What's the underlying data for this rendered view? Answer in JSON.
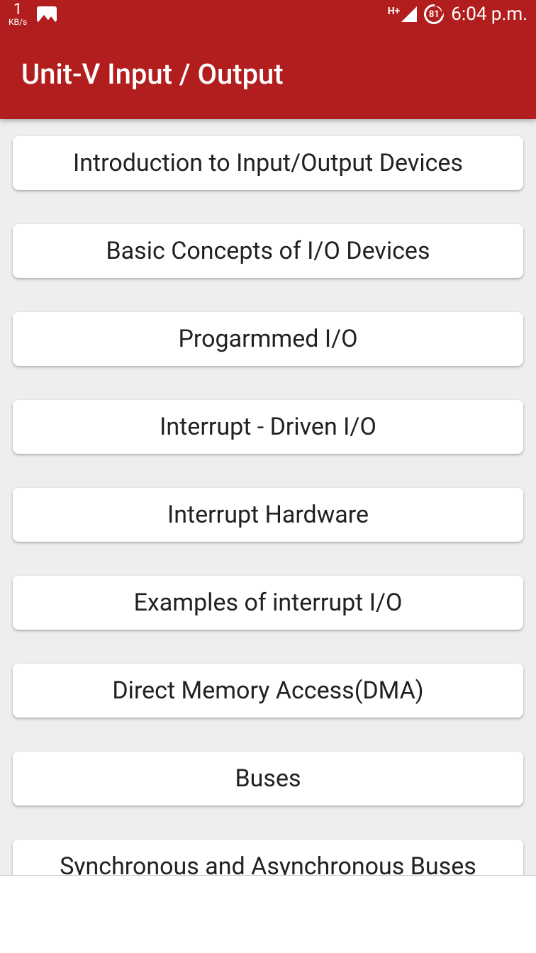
{
  "statusBar": {
    "speed": {
      "value": "1",
      "unit": "KB/s"
    },
    "networkType": "H+",
    "batteryLevel": "81",
    "time": "6:04 p.m."
  },
  "appBar": {
    "title": "Unit-V Input / Output"
  },
  "topics": [
    {
      "label": "Introduction to Input/Output Devices"
    },
    {
      "label": "Basic Concepts of I/O Devices"
    },
    {
      "label": "Progarmmed I/O"
    },
    {
      "label": "Interrupt - Driven I/O"
    },
    {
      "label": "Interrupt Hardware"
    },
    {
      "label": "Examples of interrupt I/O"
    },
    {
      "label": "Direct Memory Access(DMA)"
    },
    {
      "label": "Buses"
    },
    {
      "label": "Synchronous and Asynchronous Buses"
    }
  ]
}
